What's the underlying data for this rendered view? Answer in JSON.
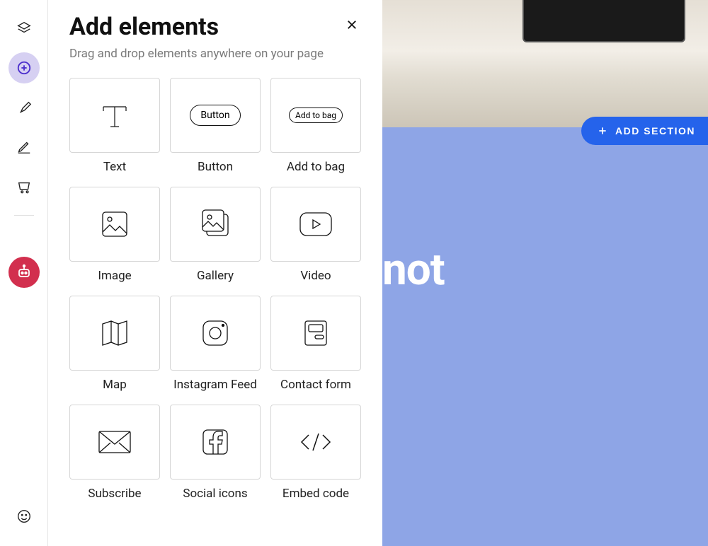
{
  "panel": {
    "title": "Add elements",
    "subtitle": "Drag and drop elements anywhere on your page",
    "elements": [
      {
        "label": "Text",
        "icon": "text"
      },
      {
        "label": "Button",
        "icon": "button"
      },
      {
        "label": "Add to bag",
        "icon": "addtobag"
      },
      {
        "label": "Image",
        "icon": "image"
      },
      {
        "label": "Gallery",
        "icon": "gallery"
      },
      {
        "label": "Video",
        "icon": "video"
      },
      {
        "label": "Map",
        "icon": "map"
      },
      {
        "label": "Instagram Feed",
        "icon": "instagram"
      },
      {
        "label": "Contact form",
        "icon": "form"
      },
      {
        "label": "Subscribe",
        "icon": "envelope"
      },
      {
        "label": "Social icons",
        "icon": "facebook"
      },
      {
        "label": "Embed code",
        "icon": "code"
      }
    ]
  },
  "canvas": {
    "add_section_label": "ADD SECTION",
    "bg_text_fragment": "not"
  },
  "element_inner_labels": {
    "button_text": "Button",
    "add_to_bag_text": "Add to bag"
  }
}
